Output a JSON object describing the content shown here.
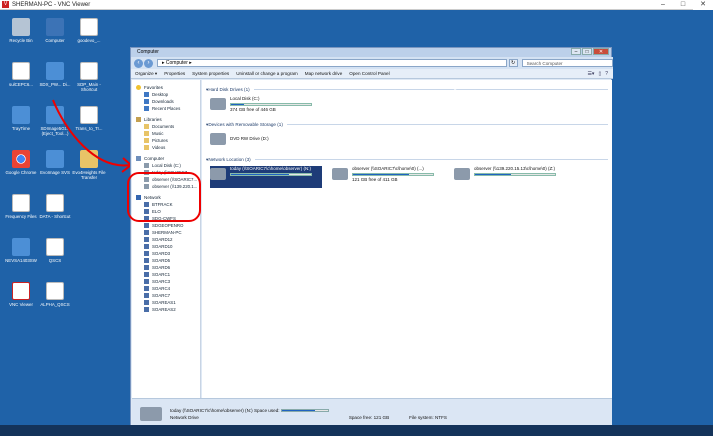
{
  "vnc": {
    "title": "SHERMAN-PC - VNC Viewer"
  },
  "desktop_icons": [
    {
      "label": "Recycle Bin",
      "icon": "recycle-bin-icon"
    },
    {
      "label": "Computer",
      "icon": "computer-icon"
    },
    {
      "label": "goodevo_...",
      "icon": "document-icon"
    },
    {
      "label": "sulCEPC6...",
      "icon": "shortcut-icon"
    },
    {
      "label": "SDX_PW... Di...",
      "icon": "app-icon"
    },
    {
      "label": "SDP_Main - Shortcut",
      "icon": "document-icon"
    },
    {
      "label": "TrayTime",
      "icon": "app-icon"
    },
    {
      "label": "SDImage5Gt... (Eject_Tool...)",
      "icon": "app-icon"
    },
    {
      "label": "Trans_to_Tr...",
      "icon": "document-icon"
    },
    {
      "label": "Google Chrome",
      "icon": "chrome-icon"
    },
    {
      "label": "EvoImage SVS",
      "icon": "app-icon"
    },
    {
      "label": "Evo4Heights File Transfer",
      "icon": "folder-icon"
    },
    {
      "label": "Frequency Files",
      "icon": "document-icon"
    },
    {
      "label": "DATA - Shortcut",
      "icon": "document-icon"
    },
    {
      "label": "NEVSA1403SW",
      "icon": "app-icon"
    },
    {
      "label": "QSCS",
      "icon": "document-icon"
    },
    {
      "label": "VNC Viewer",
      "icon": "vnc-icon"
    },
    {
      "label": "ALPHA_QSCS",
      "icon": "document-icon"
    }
  ],
  "explorer": {
    "title": "Computer",
    "address": "Computer",
    "search_placeholder": "Search Computer",
    "toolbar": [
      "Organize ▾",
      "Properties",
      "System properties",
      "Uninstall or change a program",
      "Map network drive",
      "Open Control Panel"
    ],
    "nav": {
      "favorites_label": "Favorites",
      "favorites": [
        "Desktop",
        "Downloads",
        "Recent Places"
      ],
      "libraries_label": "Libraries",
      "libraries": [
        "Documents",
        "Music",
        "Pictures",
        "Videos"
      ],
      "computer_label": "Computer",
      "computer": [
        "Local Disk (C:)",
        "today (\\\\SOARIC7...",
        "observer (\\\\SOARIC7...",
        "observer (\\\\139.220.1..."
      ],
      "network_label": "Network",
      "network": [
        "BTFRACK",
        "ELO",
        "SDG-CWFS",
        "SDGEOPENRO",
        "SHERMAN-PC",
        "SOARD12",
        "SOARD10",
        "SOARD3",
        "SOARD5",
        "SOARD6",
        "SOARC1",
        "SOARC3",
        "SOARC4",
        "SOARC7",
        "SOAREAS1",
        "SOAREAS2"
      ]
    },
    "sections": {
      "hdd": "Hard Disk Drives (1)",
      "removable": "Devices with Removable Storage (1)",
      "netloc": "Network Location (3)"
    },
    "local_disk": {
      "name": "Local Disk (C:)",
      "free": "374 GB free of 446 GB",
      "used_fraction": 0.16
    },
    "dvd": {
      "name": "DVD RW Drive (D:)"
    },
    "net_drives": [
      {
        "name": "today (\\\\SOARIC7\\c\\home\\observer) (N:)",
        "free": "",
        "used_fraction": 0.72,
        "selected": true
      },
      {
        "name": "observer (\\\\SOARIC7\\c\\home\\0) (...)",
        "free": "121 GB free of 411 GB",
        "used_fraction": 0.7,
        "selected": false
      },
      {
        "name": "observer (\\\\139.220.15.13\\c\\home\\0) (Z:)",
        "free": "",
        "used_fraction": 0.45,
        "selected": false
      }
    ],
    "status": {
      "name": "today (\\\\SOARIC7\\c\\home\\observer) (N:)  Space used:",
      "type": "Network Drive",
      "space_free": "Space free: 121 GB",
      "filesystem": "File system: NTFS",
      "used_fraction": 0.72
    }
  }
}
